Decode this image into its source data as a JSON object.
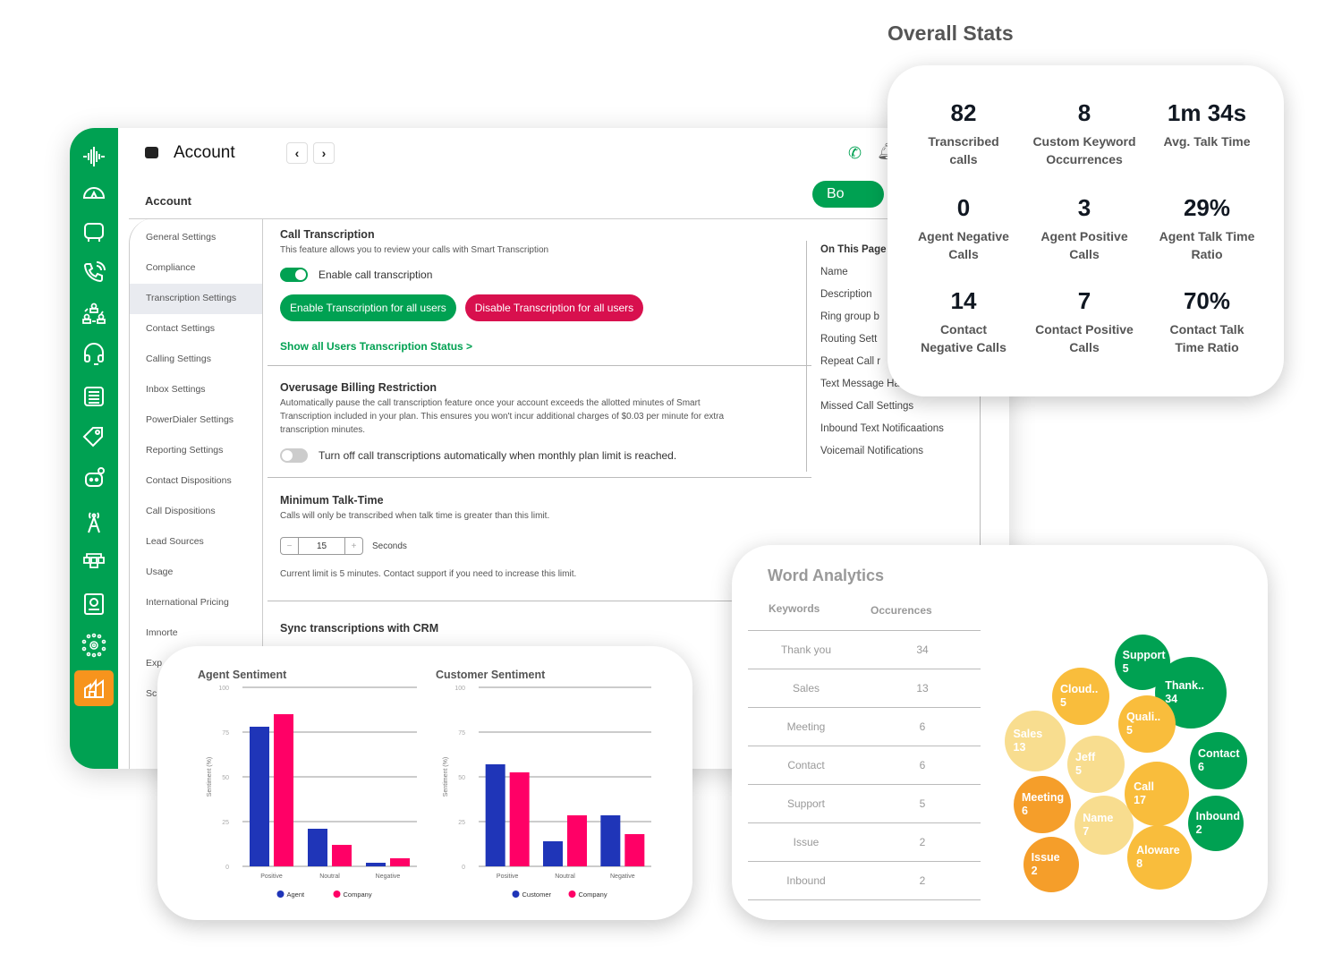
{
  "app": {
    "title": "Account",
    "breadcrumb": "Account",
    "book_button_label": "Bo",
    "subnav": [
      "General Settings",
      "Compliance",
      "Transcription Settings",
      "Contact Settings",
      "Calling Settings",
      "Inbox Settings",
      "PowerDialer Settings",
      "Reporting Settings",
      "Contact Dispositions",
      "Call Dispositions",
      "Lead Sources",
      "Usage",
      "International Pricing",
      "Imnorte",
      "Exp",
      "Sc"
    ],
    "subnav_active": "Transcription Settings",
    "call_transcription": {
      "title": "Call Transcription",
      "desc": "This feature allows you to review your calls with Smart Transcription",
      "toggle_label": "Enable call transcription",
      "toggle_on": true,
      "enable_all_label": "Enable Transcription for all users",
      "disable_all_label": "Disable Transcription for all users",
      "status_link": "Show all Users Transcription Status >"
    },
    "overusage": {
      "title": "Overusage Billing Restriction",
      "desc": "Automatically pause the call transcription feature once your account exceeds the allotted minutes of Smart Transcription included in your plan. This ensures you won't incur additional charges of $0.03 per minute for extra transcription minutes.",
      "toggle_label": "Turn off call transcriptions automatically when monthly plan limit is reached.",
      "toggle_on": false
    },
    "min_talk_time": {
      "title": "Minimum Talk-Time",
      "desc": "Calls will only be transcribed when talk time is greater than this limit.",
      "value": "15",
      "minus": "−",
      "plus": "+",
      "unit": "Seconds",
      "note": "Current limit is 5 minutes. Contact support if you need to increase this limit."
    },
    "sync_crm": {
      "title": "Sync transcriptions with CRM"
    },
    "on_this_page": {
      "title": "On This Page",
      "items": [
        "Name",
        "Description",
        "Ring group b",
        "Routing Sett",
        "Repeat Call r",
        "Text Message Handling",
        "Missed Call Settings",
        "Inbound Text Notificaations",
        "Voicemail Notifications"
      ]
    },
    "colors": {
      "brand_green": "#00a152",
      "danger": "#d8104e",
      "active_rail": "#f7941d"
    }
  },
  "overall_stats": {
    "title": "Overall Stats",
    "items": [
      {
        "value": "82",
        "label1": "Transcribed",
        "label2": "calls"
      },
      {
        "value": "8",
        "label1": "Custom Keyword",
        "label2": "Occurrences"
      },
      {
        "value": "1m 34s",
        "label1": "Avg. Talk Time",
        "label2": ""
      },
      {
        "value": "0",
        "label1": "Agent Negative",
        "label2": "Calls"
      },
      {
        "value": "3",
        "label1": "Agent Positive",
        "label2": "Calls"
      },
      {
        "value": "29%",
        "label1": "Agent Talk Time",
        "label2": "Ratio"
      },
      {
        "value": "14",
        "label1": "Contact",
        "label2": "Negative Calls"
      },
      {
        "value": "7",
        "label1": "Contact Positive",
        "label2": "Calls"
      },
      {
        "value": "70%",
        "label1": "Contact Talk",
        "label2": "Time Ratio"
      }
    ]
  },
  "chart_data": [
    {
      "type": "bar",
      "title": "Agent Sentiment",
      "xlabel": "",
      "ylabel": "Sentiment (%)",
      "ylim": [
        0,
        100
      ],
      "yticks": [
        0,
        25,
        50,
        75,
        100
      ],
      "categories": [
        "Positive",
        "Noutral",
        "Negative"
      ],
      "series": [
        {
          "name": "Agent",
          "color": "#1f35b8",
          "values": [
            78,
            21,
            2
          ]
        },
        {
          "name": "Company",
          "color": "#ff0066",
          "values": [
            85,
            12,
            4.5
          ]
        }
      ],
      "grid": true,
      "legend": "bottom"
    },
    {
      "type": "bar",
      "title": "Customer Sentiment",
      "xlabel": "",
      "ylabel": "Sentiment (%)",
      "ylim": [
        0,
        100
      ],
      "yticks": [
        0,
        25,
        50,
        75,
        100
      ],
      "categories": [
        "Positive",
        "Noutral",
        "Negative"
      ],
      "series": [
        {
          "name": "Customer",
          "color": "#1f35b8",
          "values": [
            57,
            14,
            28.5
          ]
        },
        {
          "name": "Company",
          "color": "#ff0066",
          "values": [
            52.5,
            28.5,
            18
          ]
        }
      ],
      "grid": true,
      "legend": "bottom"
    }
  ],
  "word_analytics": {
    "title": "Word Analytics",
    "col_keywords": "Keywords",
    "col_occurrences": "Occurences",
    "rows": [
      {
        "keyword": "Thank you",
        "count": "34"
      },
      {
        "keyword": "Sales",
        "count": "13"
      },
      {
        "keyword": "Meeting",
        "count": "6"
      },
      {
        "keyword": "Contact",
        "count": "6"
      },
      {
        "keyword": "Support",
        "count": "5"
      },
      {
        "keyword": "Issue",
        "count": "2"
      },
      {
        "keyword": "Inbound",
        "count": "2"
      }
    ],
    "bubbles": [
      {
        "label": "Support",
        "count": "5",
        "color": "#00a152"
      },
      {
        "label": "Thank..",
        "count": "34",
        "color": "#00a152"
      },
      {
        "label": "Cloud..",
        "count": "5",
        "color": "#f9bd3c"
      },
      {
        "label": "Quali..",
        "count": "5",
        "color": "#f9bd3c"
      },
      {
        "label": "Sales",
        "count": "13",
        "color": "#f8dd8f"
      },
      {
        "label": "Jeff",
        "count": "5",
        "color": "#f8dd8f"
      },
      {
        "label": "Contact",
        "count": "6",
        "color": "#00a152"
      },
      {
        "label": "Call",
        "count": "17",
        "color": "#f9bd3c"
      },
      {
        "label": "Meeting",
        "count": "6",
        "color": "#f59e2a"
      },
      {
        "label": "Name",
        "count": "7",
        "color": "#f8dd8f"
      },
      {
        "label": "Inbound",
        "count": "2",
        "color": "#00a152"
      },
      {
        "label": "Issue",
        "count": "2",
        "color": "#f59e2a"
      },
      {
        "label": "Aloware",
        "count": "8",
        "color": "#f9bd3c"
      }
    ]
  }
}
